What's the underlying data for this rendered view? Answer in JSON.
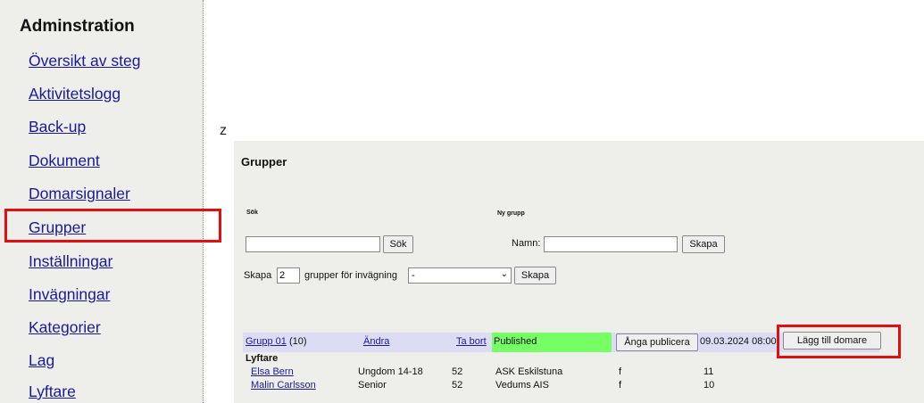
{
  "sidebar": {
    "title": "Adminstration",
    "items": [
      {
        "label": "Översikt av steg"
      },
      {
        "label": "Aktivitetslogg"
      },
      {
        "label": "Back-up"
      },
      {
        "label": "Dokument"
      },
      {
        "label": "Domarsignaler"
      },
      {
        "label": "Grupper"
      },
      {
        "label": "Inställningar"
      },
      {
        "label": "Invägningar"
      },
      {
        "label": "Kategorier"
      },
      {
        "label": "Lag"
      },
      {
        "label": "Lyftare"
      }
    ]
  },
  "stray_char": "z",
  "main": {
    "title": "Grupper",
    "search": {
      "heading": "Sök",
      "value": "",
      "button": "Sök"
    },
    "new_group": {
      "heading": "Ny grupp",
      "name_label": "Namn:",
      "value": "",
      "button": "Skapa"
    },
    "bulk": {
      "prefix": "Skapa",
      "count": "2",
      "suffix": "grupper för invägning",
      "selected": "-",
      "button": "Skapa"
    },
    "group": {
      "name": "Grupp 01",
      "count": "(10)",
      "edit": "Ändra",
      "delete": "Ta bort",
      "status": "Published",
      "unpublish": "Ånga publicera",
      "datetime": "09.03.2024 08:00",
      "add_judge": "Lägg till domare",
      "lifters_heading": "Lyftare",
      "lifters": [
        {
          "name": "Elsa Bern",
          "category": "Ungdom 14-18",
          "weight": "52",
          "club": "ASK Eskilstuna",
          "gender": "f",
          "number": "11"
        },
        {
          "name": "Malin Carlsson",
          "category": "Senior",
          "weight": "52",
          "club": "Vedums AIS",
          "gender": "f",
          "number": "10"
        }
      ]
    }
  },
  "colors": {
    "highlight": "#e01010",
    "published": "#77ff66",
    "group_row": "#dcdcf4",
    "link": "#1a1a99"
  }
}
